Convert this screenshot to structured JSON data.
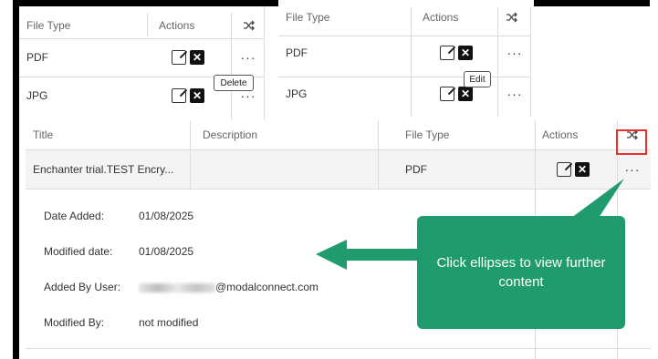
{
  "colors": {
    "callout": "#1f9b6e",
    "highlight": "#e8302c",
    "row_hover": "#f4f4f4"
  },
  "left_table": {
    "headers": {
      "file_type": "File Type",
      "actions": "Actions",
      "shuffle_icon": "shuffle-icon"
    },
    "rows": [
      {
        "file_type": "PDF",
        "more": "···"
      },
      {
        "file_type": "JPG",
        "more": "···"
      }
    ],
    "tooltip": "Delete"
  },
  "right_table": {
    "headers": {
      "file_type": "File Type",
      "actions": "Actions",
      "shuffle_icon": "shuffle-icon"
    },
    "rows": [
      {
        "file_type": "PDF",
        "more": "···"
      },
      {
        "file_type": "JPG",
        "more": "···"
      }
    ],
    "tooltip": "Edit"
  },
  "main_table": {
    "headers": {
      "title": "Title",
      "description": "Description",
      "file_type": "File Type",
      "actions": "Actions",
      "shuffle_icon": "shuffle-icon"
    },
    "row": {
      "title": "Enchanter trial.TEST Encry...",
      "description": "",
      "file_type": "PDF",
      "more": "···"
    },
    "details": [
      {
        "label": "Date Added:",
        "value": "01/08/2025"
      },
      {
        "label": "Modified date:",
        "value": "01/08/2025"
      },
      {
        "label": "Added By User:",
        "value": "@modalconnect.com"
      },
      {
        "label": "Modified By:",
        "value": "not modified"
      }
    ]
  },
  "callout": {
    "text": "Click ellipses to view further content"
  }
}
